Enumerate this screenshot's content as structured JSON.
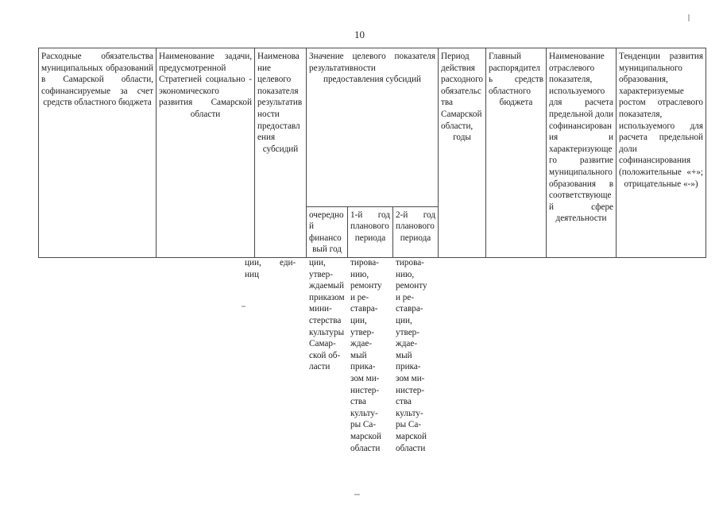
{
  "document": {
    "page_number": "10",
    "language": "ru"
  },
  "table": {
    "columns": [
      {
        "id": "col-expense-obligations",
        "header": "Расходные обязательства муниципальных образований в Самарской области, софинансируемые за счет средств областного бюджета",
        "continuation": ""
      },
      {
        "id": "col-task-name",
        "header": "Наименование задачи, предусмотренной Стратегией социально - экономического развития Самарской области",
        "continuation": ""
      },
      {
        "id": "col-target-indicator-name",
        "header": "Наименование целевого показателя результативности предоставления субсидий",
        "continuation_a": "ции,\nниц",
        "continuation_b": "еди-"
      },
      {
        "id": "col-value-group",
        "header": "Значение целевого показателя результативности предоставления субсидий",
        "subcolumns": [
          {
            "id": "col-current-financial-year",
            "header": "очередной финансовый год",
            "continuation": "ции,\nутвер-\nждаемый\nприказом\nмини-\nстерства\nкультуры\nСамар-\nской об-\nласти"
          },
          {
            "id": "col-plan-year-1",
            "header": "1-й год планового периода",
            "continuation": "тирова-\nнию,\nремонту\nи ре-\nставра-\nции,\nутвер-\nждае-\nмый\nприка-\nзом ми-\nнистер-\nства\nкульту-\nры Са-\nмарской\nобласти"
          },
          {
            "id": "col-plan-year-2",
            "header": "2-й год планового периода",
            "continuation": "тирова-\nнию,\nремонту\nи ре-\nставра-\nции,\nутвер-\nждае-\nмый\nприка-\nзом ми-\nнистер-\nства\nкульту-\nры Са-\nмарской\nобласти"
          }
        ]
      },
      {
        "id": "col-obligation-period",
        "header": "Период действия расходного обязательства Самарской области, годы",
        "continuation": ""
      },
      {
        "id": "col-chief-administrator",
        "header": "Главный распорядитель средств областного бюджета",
        "continuation": ""
      },
      {
        "id": "col-sector-indicator-name",
        "header": "Наименование отраслевого показателя, используемого для расчета предельной доли софинансирования и характеризующего развитие муниципального образования в соответствующей сфере деятельности",
        "continuation": ""
      },
      {
        "id": "col-development-trends",
        "header": "Тенденции развития муниципального образования, характеризуемые ростом отраслевого показателя, используемого для расчета предельной доли софинансирования (положительные «+»; отрицательные «-»)",
        "continuation": ""
      }
    ]
  },
  "colors": {
    "page_background": "#ffffff",
    "text": "#1d1d1d",
    "border": "#4a4a4a"
  }
}
